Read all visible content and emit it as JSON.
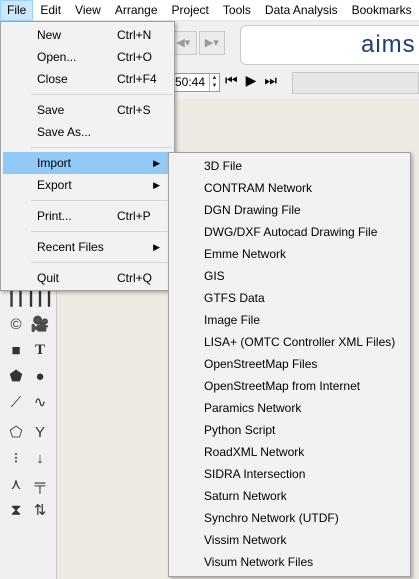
{
  "menubar": {
    "items": [
      "File",
      "Edit",
      "View",
      "Arrange",
      "Project",
      "Tools",
      "Data Analysis",
      "Bookmarks"
    ]
  },
  "app": {
    "logo_text": "aims",
    "time_value": "50:44"
  },
  "file_menu": {
    "items": [
      {
        "label": "New",
        "shortcut": "Ctrl+N"
      },
      {
        "label": "Open...",
        "shortcut": "Ctrl+O"
      },
      {
        "label": "Close",
        "shortcut": "Ctrl+F4"
      },
      {
        "label": "Save",
        "shortcut": "Ctrl+S"
      },
      {
        "label": "Save As...",
        "shortcut": ""
      },
      {
        "label": "Import",
        "shortcut": ""
      },
      {
        "label": "Export",
        "shortcut": ""
      },
      {
        "label": "Print...",
        "shortcut": "Ctrl+P"
      },
      {
        "label": "Recent Files",
        "shortcut": ""
      },
      {
        "label": "Quit",
        "shortcut": "Ctrl+Q"
      }
    ]
  },
  "import_menu": {
    "items": [
      "3D File",
      "CONTRAM Network",
      "DGN Drawing File",
      "DWG/DXF Autocad Drawing File",
      "Emme Network",
      "GIS",
      "GTFS Data",
      "Image File",
      "LISA+ (OMTC Controller XML Files)",
      "OpenStreetMap Files",
      "OpenStreetMap from Internet",
      "Paramics Network",
      "Python Script",
      "RoadXML Network",
      "SIDRA Intersection",
      "Saturn Network",
      "Synchro Network (UTDF)",
      "Vissim Network",
      "Visum Network Files"
    ]
  },
  "colors": {
    "menu_highlight": "#91c9f7",
    "menubar_active": "#cce8ff",
    "canvas": "#ede9e3"
  }
}
